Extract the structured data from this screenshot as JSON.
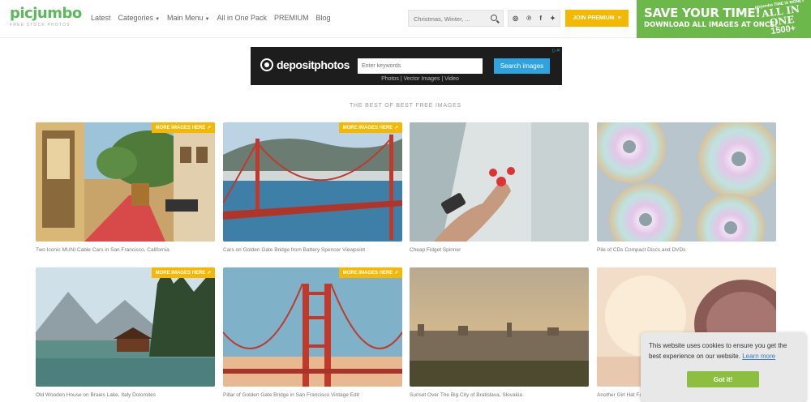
{
  "brand": {
    "logo": "picjumbo",
    "tagline": "FREE STOCK PHOTOS"
  },
  "nav": [
    {
      "label": "Latest",
      "dropdown": false
    },
    {
      "label": "Categories",
      "dropdown": true
    },
    {
      "label": "Main Menu",
      "dropdown": true
    },
    {
      "label": "All in One Pack",
      "dropdown": false
    },
    {
      "label": "PREMIUM",
      "dropdown": false
    },
    {
      "label": "Blog",
      "dropdown": false
    }
  ],
  "search": {
    "placeholder": "Christmas, Winter, ..."
  },
  "social": [
    "instagram-icon",
    "pinterest-icon",
    "facebook-icon",
    "twitter-icon"
  ],
  "join": {
    "label": "JOIN PREMIUM"
  },
  "promo": {
    "line1": "SAVE YOUR TIME!",
    "line2": "DOWNLOAD ALL IMAGES AT ONCE!",
    "badge_small": "picjumbo TIME IS MONEY",
    "badge_big": "ALL IN ONE",
    "badge_count": "1500+"
  },
  "ad": {
    "brand": "depositphotos",
    "input_placeholder": "Enter keywords",
    "button": "Search images",
    "links": "Photos  |  Vector Images  |  Video"
  },
  "section_title": "THE BEST OF BEST FREE IMAGES",
  "more_label": "MORE IMAGES HERE",
  "gallery": [
    {
      "caption": "Two Iconic MUNI Cable Cars in San Francisco, California",
      "more": true
    },
    {
      "caption": "Cars on Golden Gate Bridge from Battery Spencer Viewpoint",
      "more": true
    },
    {
      "caption": "Cheap Fidget Spinner",
      "more": false
    },
    {
      "caption": "Pile of CDs Compact Discs and DVDs",
      "more": false
    },
    {
      "caption": "Old Wooden House on Braies Lake, Italy Dolomites",
      "more": true
    },
    {
      "caption": "Pillar of Golden Gate Bridge in San Francisco Vintage Edit",
      "more": true
    },
    {
      "caption": "Sunset Over The Big City of Bratislava, Slovakia",
      "more": false
    },
    {
      "caption": "Another Girl Hat Fashion",
      "more": false
    }
  ],
  "cookie": {
    "text": "This website uses cookies to ensure you get the best experience on our website.",
    "link": "Learn more",
    "button": "Got it!"
  }
}
